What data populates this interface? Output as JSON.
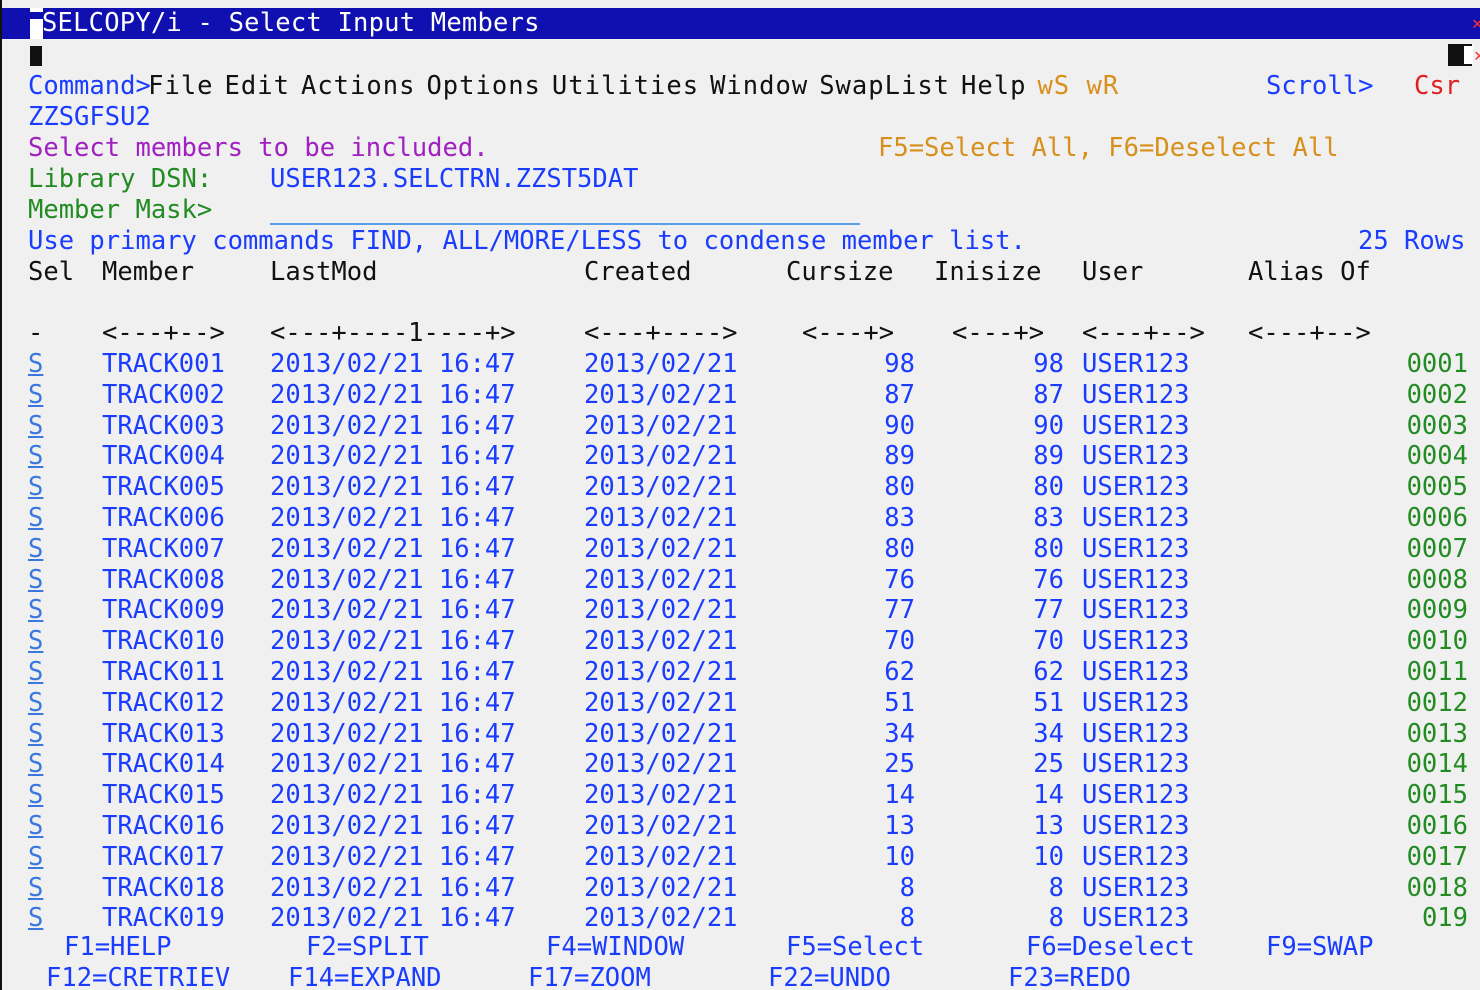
{
  "title": "SELCOPY/i - Select Input Members",
  "menu": [
    "File",
    "Edit",
    "Actions",
    "Options",
    "Utilities",
    "Window",
    "SwapList",
    "Help"
  ],
  "window_shortcuts": "wS wR",
  "command_label": "Command>",
  "scroll_label": "Scroll>",
  "scroll_value": "Csr",
  "panel_id": "ZZSGFSU2",
  "instruction": "Select members to be included.",
  "function_hint": "F5=Select All, F6=Deselect All",
  "library_label": "Library DSN:",
  "library_dsn": "USER123.SELCTRN.ZZST5DAT",
  "member_mask_label": "Member Mask>",
  "member_mask_value": "",
  "usage_hint": "Use primary commands FIND, ALL/MORE/LESS to condense member list.",
  "rows_info": "25 Rows",
  "headers": {
    "sel": "Sel",
    "member": "Member",
    "lastmod": "LastMod",
    "created": "Created",
    "cursize": "Cursize",
    "inisize": "Inisize",
    "user": "User",
    "alias": "Alias Of"
  },
  "ruler": {
    "sel": "-",
    "member": "<---+-->",
    "lastmod": "<---+----1----+>",
    "created": "<---+---->",
    "cursize": "<---+>",
    "inisize": "<---+>",
    "user": "<---+-->",
    "alias": "<---+-->"
  },
  "rows": [
    {
      "sel": "S",
      "member": "TRACK001",
      "lastmod": "2013/02/21 16:47",
      "created": "2013/02/21",
      "cursize": "98",
      "inisize": "98",
      "user": "USER123",
      "alias": "0001"
    },
    {
      "sel": "S",
      "member": "TRACK002",
      "lastmod": "2013/02/21 16:47",
      "created": "2013/02/21",
      "cursize": "87",
      "inisize": "87",
      "user": "USER123",
      "alias": "0002"
    },
    {
      "sel": "S",
      "member": "TRACK003",
      "lastmod": "2013/02/21 16:47",
      "created": "2013/02/21",
      "cursize": "90",
      "inisize": "90",
      "user": "USER123",
      "alias": "0003"
    },
    {
      "sel": "S",
      "member": "TRACK004",
      "lastmod": "2013/02/21 16:47",
      "created": "2013/02/21",
      "cursize": "89",
      "inisize": "89",
      "user": "USER123",
      "alias": "0004"
    },
    {
      "sel": "S",
      "member": "TRACK005",
      "lastmod": "2013/02/21 16:47",
      "created": "2013/02/21",
      "cursize": "80",
      "inisize": "80",
      "user": "USER123",
      "alias": "0005"
    },
    {
      "sel": "S",
      "member": "TRACK006",
      "lastmod": "2013/02/21 16:47",
      "created": "2013/02/21",
      "cursize": "83",
      "inisize": "83",
      "user": "USER123",
      "alias": "0006"
    },
    {
      "sel": "S",
      "member": "TRACK007",
      "lastmod": "2013/02/21 16:47",
      "created": "2013/02/21",
      "cursize": "80",
      "inisize": "80",
      "user": "USER123",
      "alias": "0007"
    },
    {
      "sel": "S",
      "member": "TRACK008",
      "lastmod": "2013/02/21 16:47",
      "created": "2013/02/21",
      "cursize": "76",
      "inisize": "76",
      "user": "USER123",
      "alias": "0008"
    },
    {
      "sel": "S",
      "member": "TRACK009",
      "lastmod": "2013/02/21 16:47",
      "created": "2013/02/21",
      "cursize": "77",
      "inisize": "77",
      "user": "USER123",
      "alias": "0009"
    },
    {
      "sel": "S",
      "member": "TRACK010",
      "lastmod": "2013/02/21 16:47",
      "created": "2013/02/21",
      "cursize": "70",
      "inisize": "70",
      "user": "USER123",
      "alias": "0010"
    },
    {
      "sel": "S",
      "member": "TRACK011",
      "lastmod": "2013/02/21 16:47",
      "created": "2013/02/21",
      "cursize": "62",
      "inisize": "62",
      "user": "USER123",
      "alias": "0011"
    },
    {
      "sel": "S",
      "member": "TRACK012",
      "lastmod": "2013/02/21 16:47",
      "created": "2013/02/21",
      "cursize": "51",
      "inisize": "51",
      "user": "USER123",
      "alias": "0012"
    },
    {
      "sel": "S",
      "member": "TRACK013",
      "lastmod": "2013/02/21 16:47",
      "created": "2013/02/21",
      "cursize": "34",
      "inisize": "34",
      "user": "USER123",
      "alias": "0013"
    },
    {
      "sel": "S",
      "member": "TRACK014",
      "lastmod": "2013/02/21 16:47",
      "created": "2013/02/21",
      "cursize": "25",
      "inisize": "25",
      "user": "USER123",
      "alias": "0014"
    },
    {
      "sel": "S",
      "member": "TRACK015",
      "lastmod": "2013/02/21 16:47",
      "created": "2013/02/21",
      "cursize": "14",
      "inisize": "14",
      "user": "USER123",
      "alias": "0015"
    },
    {
      "sel": "S",
      "member": "TRACK016",
      "lastmod": "2013/02/21 16:47",
      "created": "2013/02/21",
      "cursize": "13",
      "inisize": "13",
      "user": "USER123",
      "alias": "0016"
    },
    {
      "sel": "S",
      "member": "TRACK017",
      "lastmod": "2013/02/21 16:47",
      "created": "2013/02/21",
      "cursize": "10",
      "inisize": "10",
      "user": "USER123",
      "alias": "0017"
    },
    {
      "sel": "S",
      "member": "TRACK018",
      "lastmod": "2013/02/21 16:47",
      "created": "2013/02/21",
      "cursize": "8",
      "inisize": "8",
      "user": "USER123",
      "alias": "0018"
    },
    {
      "sel": "S",
      "member": "TRACK019",
      "lastmod": "2013/02/21 16:47",
      "created": "2013/02/21",
      "cursize": "8",
      "inisize": "8",
      "user": "USER123",
      "alias": "019"
    }
  ],
  "fkeys_row1": [
    "F1=HELP",
    "F2=SPLIT",
    "F4=WINDOW",
    "F5=Select",
    "F6=Deselect",
    "F9=SWAP"
  ],
  "fkeys_row2": [
    "F12=CRETRIEV",
    "F14=EXPAND",
    "F17=ZOOM",
    "F22=UNDO",
    "F23=REDO"
  ],
  "colors": {
    "titlebar_bg": "#1010b0",
    "background": "#f0f0f0",
    "data_text": "#1a3cff",
    "alias_text": "#228b22",
    "instruction": "#a020c0",
    "hint": "#d8901c",
    "scroll_value": "#e02020"
  }
}
